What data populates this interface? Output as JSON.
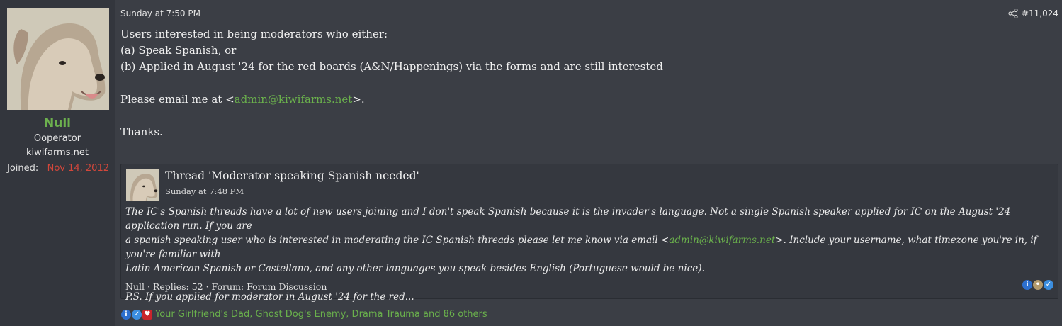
{
  "user": {
    "name": "Null",
    "title": "Ooperator",
    "site": "kiwifarms.net",
    "joined_label": "Joined:",
    "joined_date": "Nov 14, 2012",
    "avatar_icon": "dog-avatar-icon"
  },
  "post": {
    "timestamp": "Sunday at 7:50 PM",
    "number": "#11,024",
    "share_icon": "share-icon",
    "lines": {
      "l1": "Users interested in being moderators who either:",
      "l2": "(a) Speak Spanish, or",
      "l3": "(b) Applied in August '24 for the red boards (A&N/Happenings) via the forms and are still interested",
      "l4_pre": "Please email me at <",
      "l4_link": "admin@kiwifarms.net",
      "l4_post": ">.",
      "l5": "Thanks."
    }
  },
  "quote": {
    "title": "Thread 'Moderator speaking Spanish needed'",
    "time": "Sunday at 7:48 PM",
    "p1_pre": "The IC's Spanish threads have a lot of new users joining and I don't speak Spanish because it is the invader's language. Not a single Spanish speaker applied for IC on the August '24 application run. If you are",
    "p1_mid_pre": "a spanish speaking user who is interested in moderating the IC Spanish threads please let me know via email <",
    "p1_link": "admin@kiwifarms.net",
    "p1_mid_post": ">. Include your username, what timezone you're in, if you're familiar with",
    "p1_end": "Latin American Spanish or Castellano, and any other languages you speak besides English (Portuguese would be nice).",
    "p2": "P.S. If you applied for moderator in August '24 for the red...",
    "meta": "Null · Replies: 52 · Forum: Forum Discussion"
  },
  "reactions": {
    "text": "Your Girlfriend's Dad, Ghost Dog's Enemy, Drama Trauma and 86 others",
    "icons": [
      "informative-icon",
      "like-icon",
      "heart-icon"
    ]
  },
  "colors": {
    "background": "#3b3e45",
    "username": "#6cb04e",
    "joined_date": "#d3473b",
    "link": "#6ab04c"
  }
}
